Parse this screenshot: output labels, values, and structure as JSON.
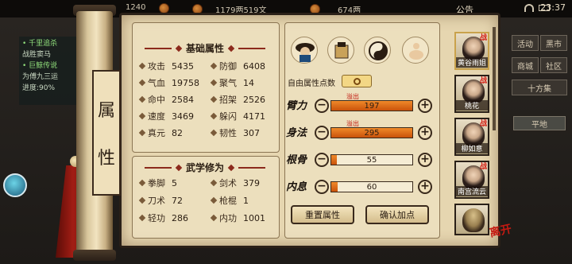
{
  "topbar": {
    "left_value": "1240",
    "money": "1179两519文",
    "gold": "674两",
    "notice": "公告",
    "clock": "23:37"
  },
  "quest": {
    "lines": [
      "• 千里追杀",
      "战胜窦马",
      "• 巨鲸传说",
      "为傅九三运",
      "进度:90%"
    ]
  },
  "right_menu": {
    "row1": [
      "活动",
      "黑市"
    ],
    "row2": [
      "商城",
      "社区"
    ],
    "row3": "十方集",
    "row4": "平地"
  },
  "scroll_title": [
    "属",
    "性"
  ],
  "basic": {
    "title": "基础属性",
    "stats": [
      {
        "label": "攻击",
        "value": "5435"
      },
      {
        "label": "防御",
        "value": "6408"
      },
      {
        "label": "气血",
        "value": "19758"
      },
      {
        "label": "聚气",
        "value": "14"
      },
      {
        "label": "命中",
        "value": "2584"
      },
      {
        "label": "招架",
        "value": "2526"
      },
      {
        "label": "速度",
        "value": "3469"
      },
      {
        "label": "躲闪",
        "value": "4171"
      },
      {
        "label": "真元",
        "value": "82"
      },
      {
        "label": "韧性",
        "value": "307"
      }
    ]
  },
  "martial": {
    "title": "武学修为",
    "stats": [
      {
        "label": "拳脚",
        "value": "5"
      },
      {
        "label": "剑术",
        "value": "379"
      },
      {
        "label": "刀术",
        "value": "72"
      },
      {
        "label": "枪棍",
        "value": "1"
      },
      {
        "label": "轻功",
        "value": "286"
      },
      {
        "label": "内功",
        "value": "1001"
      }
    ]
  },
  "free_points_label": "自由属性点数",
  "attributes": [
    {
      "label": "臂力",
      "value": "197",
      "overflow": "溢出",
      "fill": 1.0
    },
    {
      "label": "身法",
      "value": "295",
      "overflow": "溢出",
      "fill": 1.0
    },
    {
      "label": "根骨",
      "value": "55",
      "overflow": "",
      "fill": 0.07
    },
    {
      "label": "内息",
      "value": "60",
      "overflow": "",
      "fill": 0.08
    }
  ],
  "buttons": {
    "reset": "重置属性",
    "confirm": "确认加点"
  },
  "roster": [
    {
      "name": "黄谷雨姐",
      "battle": "战"
    },
    {
      "name": "桃花",
      "battle": "战"
    },
    {
      "name": "柳如意",
      "battle": "战"
    },
    {
      "name": "南宫流云",
      "battle": "战"
    },
    {
      "name": "",
      "battle": ""
    }
  ],
  "leave_tag": "离开",
  "icons": [
    "coin-icon",
    "money-icon",
    "gold-icon",
    "wifi-icon",
    "battery-icon",
    "hero-portrait-icon",
    "inventory-icon",
    "taiji-icon",
    "meditation-icon"
  ]
}
